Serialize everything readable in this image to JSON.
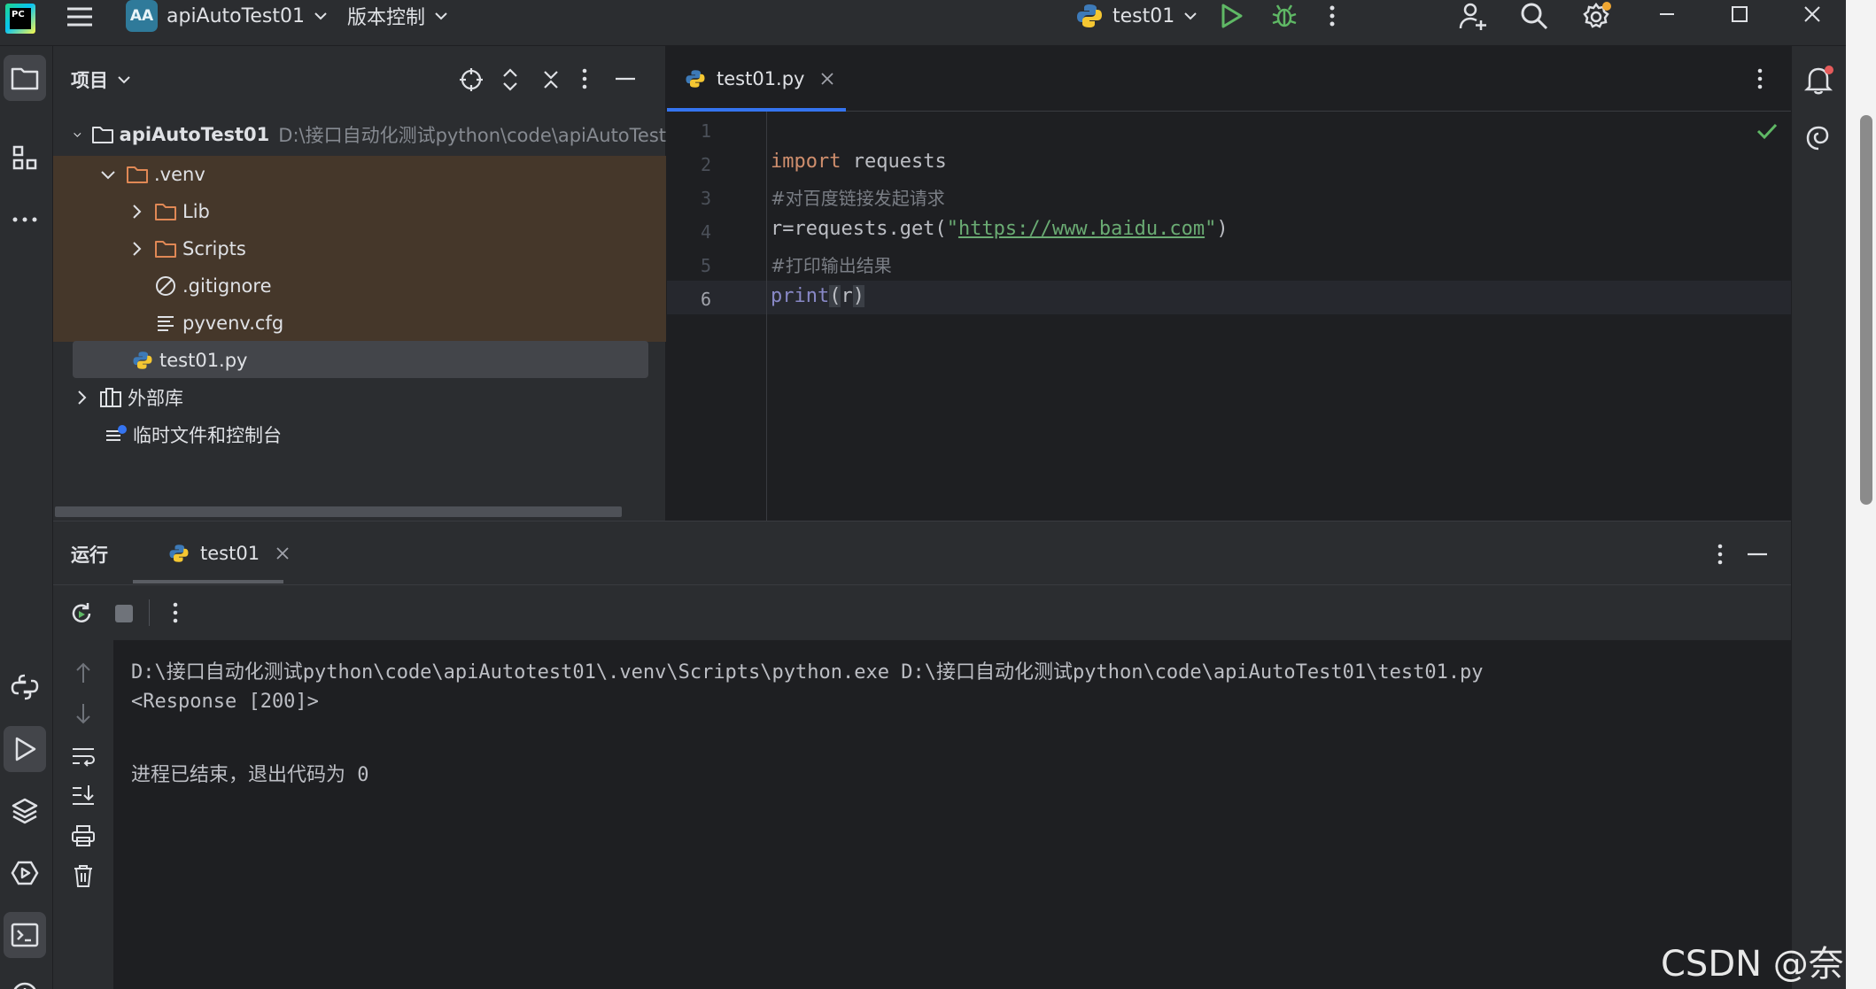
{
  "titlebar": {
    "logo_text": "PC",
    "project_badge": "AA",
    "project_name": "apiAutoTest01",
    "vcs_label": "版本控制",
    "run_config": "test01"
  },
  "project_panel": {
    "title": "项目",
    "root": {
      "name": "apiAutoTest01",
      "path": "D:\\接口自动化测试python\\code\\apiAutoTest"
    },
    "items": [
      {
        "name": ".venv"
      },
      {
        "name": "Lib"
      },
      {
        "name": "Scripts"
      },
      {
        "name": ".gitignore"
      },
      {
        "name": "pyvenv.cfg"
      },
      {
        "name": "test01.py"
      },
      {
        "name": "外部库"
      },
      {
        "name": "临时文件和控制台"
      }
    ]
  },
  "editor": {
    "tab_label": "test01.py",
    "line_numbers": [
      "1",
      "2",
      "3",
      "4",
      "5",
      "6"
    ],
    "lines": {
      "l2_kw": "import",
      "l2_rest": " requests",
      "l3": "#对百度链接发起请求",
      "l4_pre": "r=requests.get(",
      "l4_q1": "\"",
      "l4_url": "https://www.baidu.com",
      "l4_q2": "\"",
      "l4_post": ")",
      "l5": "#打印输出结果",
      "l6_fn": "print",
      "l6_open": "(",
      "l6_arg": "r",
      "l6_close": ")"
    }
  },
  "run_panel": {
    "title": "运行",
    "tab_label": "test01",
    "output": [
      "D:\\接口自动化测试python\\code\\apiAutotest01\\.venv\\Scripts\\python.exe D:\\接口自动化测试python\\code\\apiAutoTest01\\test01.py",
      "<Response [200]>",
      "",
      "进程已结束，退出代码为 0"
    ]
  },
  "watermark": "CSDN @奈葵",
  "colors": {
    "accent": "#3574f0",
    "run_green": "#5fb865",
    "keyword": "#cf8e6d",
    "string": "#6aab73",
    "comment": "#7a7e85"
  }
}
